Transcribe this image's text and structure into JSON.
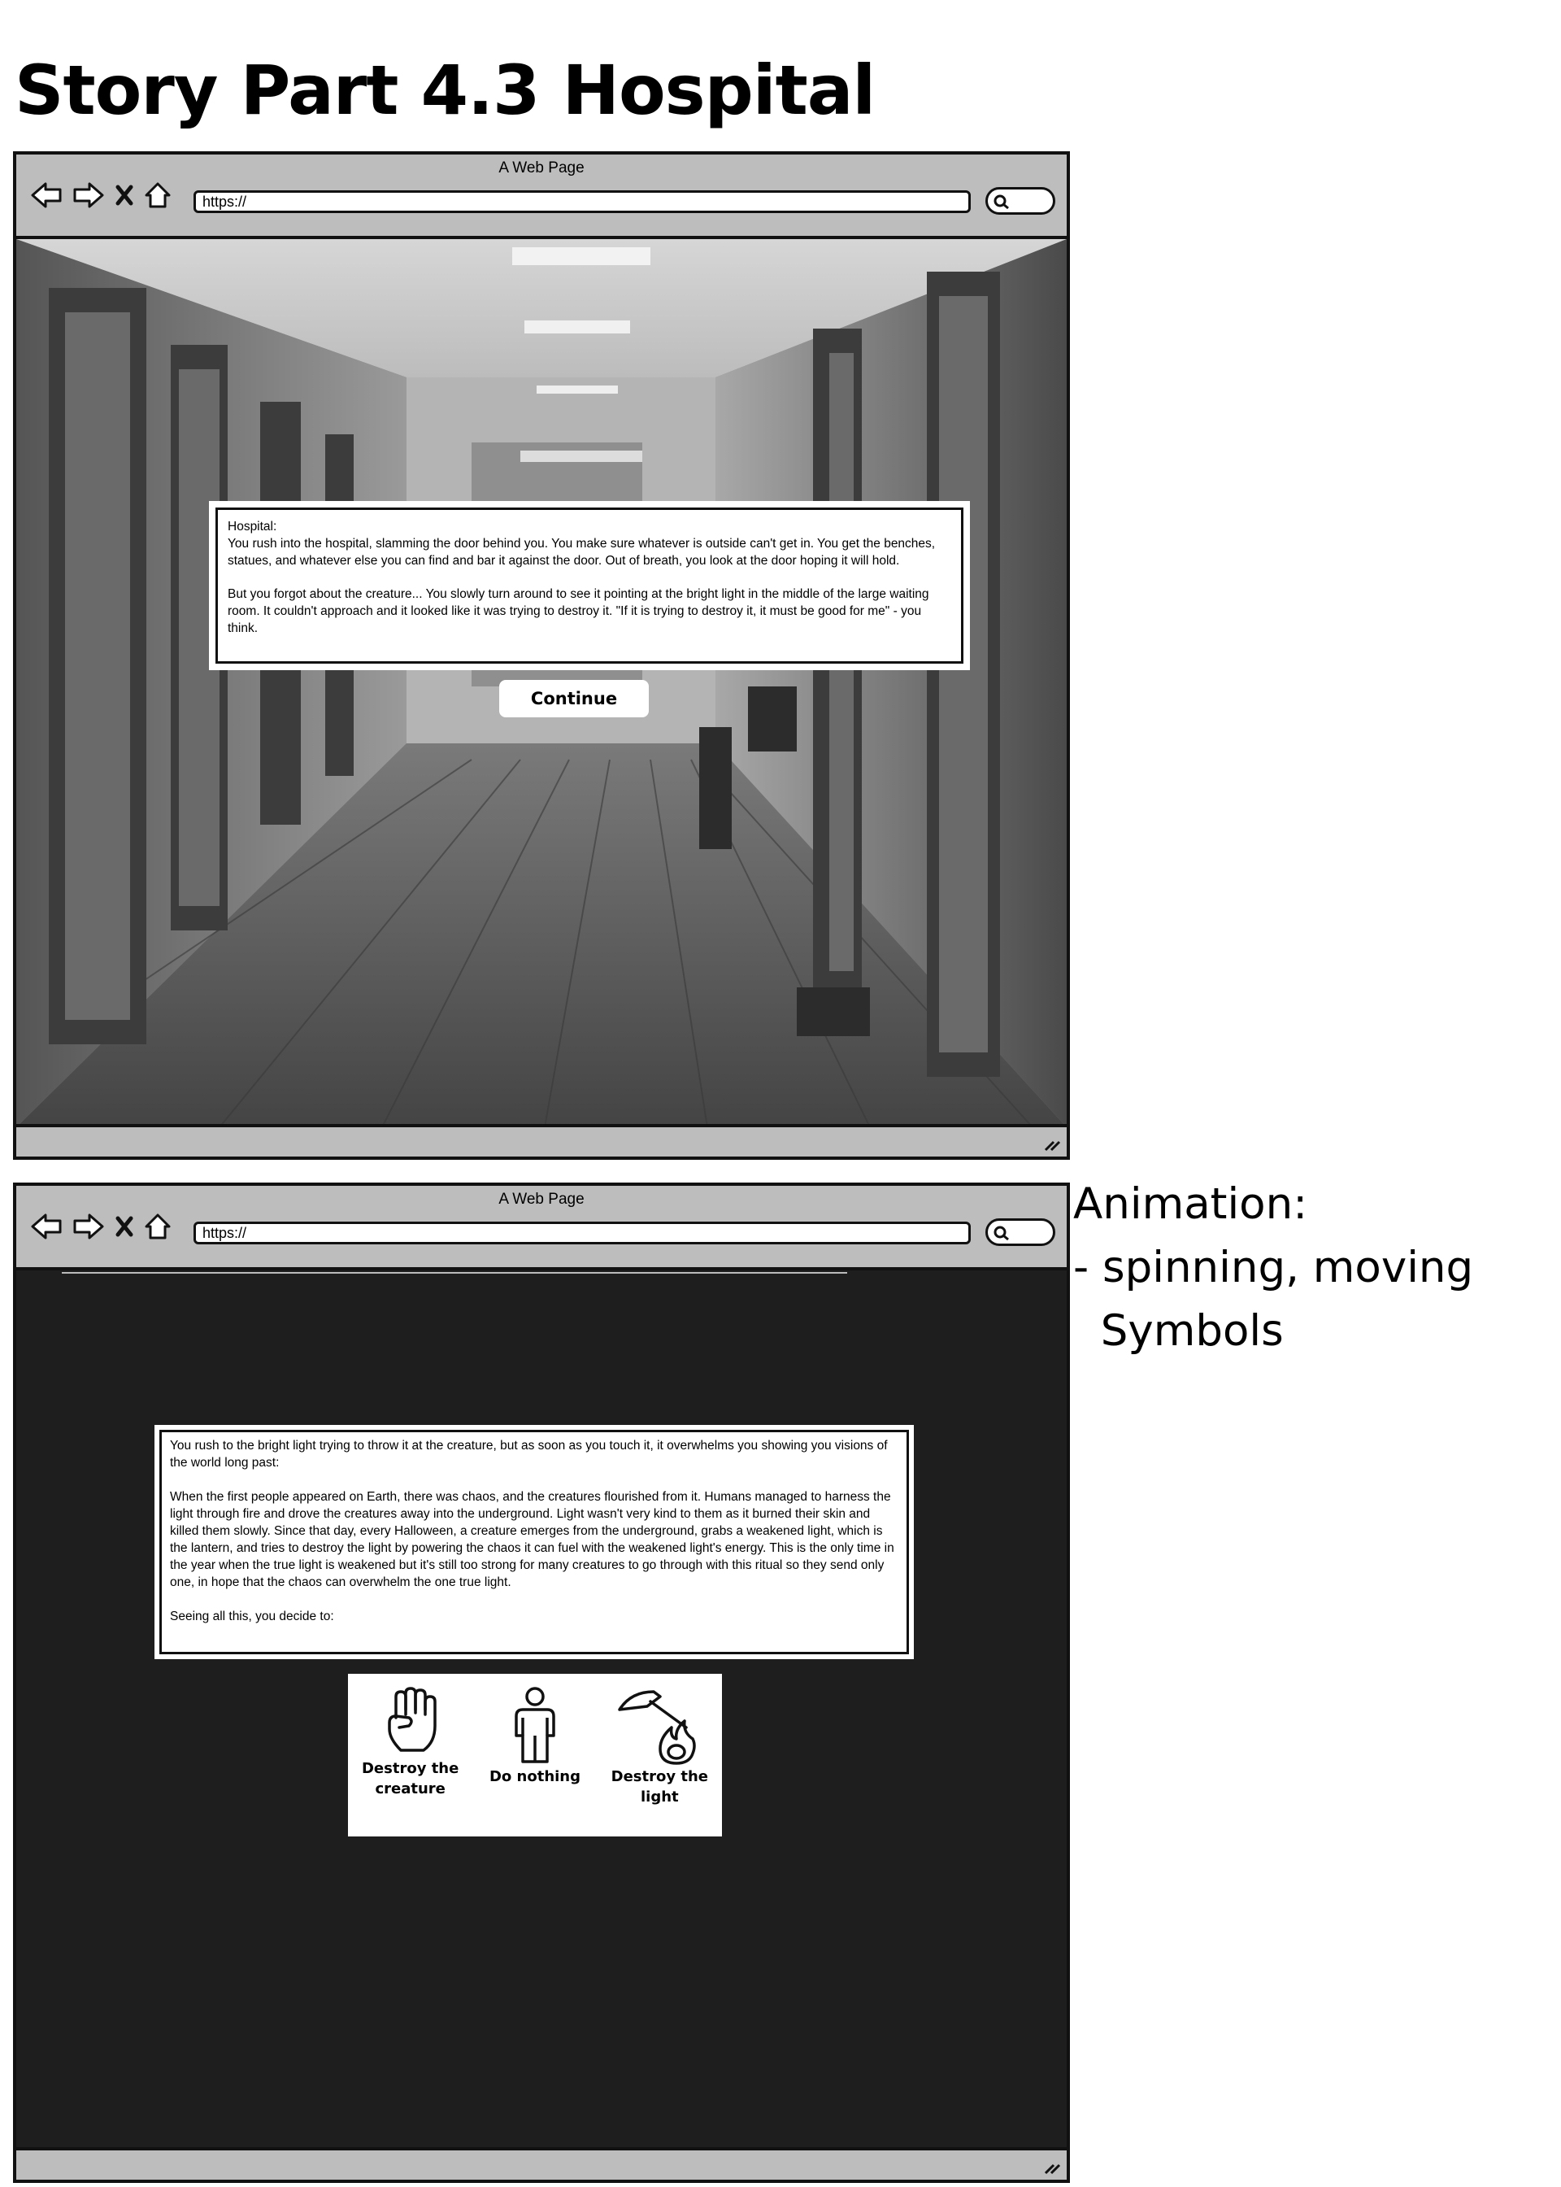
{
  "page_title": "Story Part 4.3 Hospital",
  "browser1": {
    "window_title": "A Web Page",
    "url": "https://",
    "story": {
      "heading": "Hospital:",
      "paragraph1": "You rush into the hospital, slamming the door behind you. You make sure whatever is outside can't get in. You get the benches, statues, and whatever else you can find and bar it against the door. Out of breath, you look at the door hoping it will hold.",
      "paragraph2": "But you forgot about the creature... You slowly turn around  to see it pointing at the bright light in the middle of the large waiting room. It couldn't approach and it looked like it was trying to destroy it. \"If it is trying to destroy it, it must be good for me\" - you think."
    },
    "continue_label": "Continue"
  },
  "browser2": {
    "window_title": "A Web Page",
    "url": "https://",
    "vision": {
      "paragraph1": "You rush to the bright light trying to throw it at the creature, but as soon as you touch it, it overwhelms you showing you visions of the world long past:",
      "paragraph2": "When the first people appeared on Earth, there was chaos, and the creatures flourished from it. Humans managed to harness the light through fire and drove the creatures away into the underground. Light wasn't very kind to them as it burned their skin and killed them slowly. Since that day, every Halloween, a creature emerges from the underground, grabs a weakened light, which is the lantern, and tries to destroy the light by powering the chaos it can fuel with the weakened light's energy. This is the only time in the year when the true light is weakened but it's still too strong for many creatures to go through with this ritual so they send only one, in hope that the chaos can overwhelm the one true light.",
      "paragraph3": "Seeing all this, you decide to:"
    },
    "choices": [
      {
        "icon": "raised-fist-icon",
        "label": "Destroy the creature"
      },
      {
        "icon": "standing-person-icon",
        "label": "Do nothing"
      },
      {
        "icon": "hammer-fire-icon",
        "label": "Destroy the light"
      }
    ]
  },
  "side_note": {
    "line1": "Animation:",
    "line2": "- spinning, moving",
    "line3": "  Symbols"
  }
}
